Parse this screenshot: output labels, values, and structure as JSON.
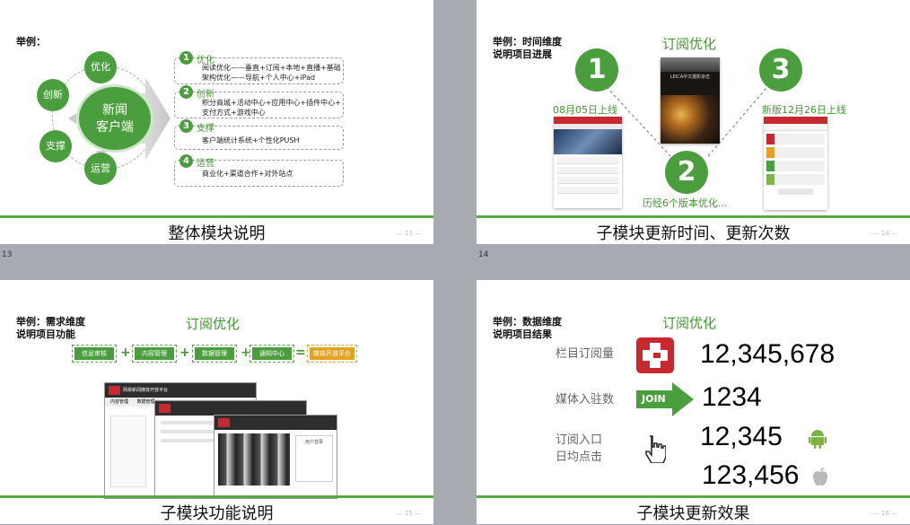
{
  "slides": [
    {
      "number": "13",
      "example": "举例：",
      "hub": "新闻客户端",
      "hub_line1": "新闻",
      "hub_line2": "客户端",
      "satellites": [
        "优化",
        "创新",
        "支撑",
        "运营"
      ],
      "items": [
        {
          "num": "1",
          "label": "优化",
          "lines": [
            "阅读优化——垂直+订阅+本地+直播+基础",
            "架构优化——导航+个人中心+iPad"
          ]
        },
        {
          "num": "2",
          "label": "创新",
          "lines": [
            "积分商城+活动中心+应用中心+插件中心+",
            "支付方式+游戏中心"
          ]
        },
        {
          "num": "3",
          "label": "支撑",
          "lines": [
            "客户端统计系统+个性化PUSH"
          ]
        },
        {
          "num": "4",
          "label": "运营",
          "lines": [
            "商业化+渠道合作+对外站点"
          ]
        }
      ],
      "title": "整体模块说明",
      "page": "— 13 —"
    },
    {
      "number": "14",
      "example_line1": "举例：时间维度",
      "example_line2": "说明项目进展",
      "heading": "订阅优化",
      "step1": "1",
      "step2": "2",
      "step3": "3",
      "label1": "08月05日上线",
      "label2": "历经6个版本优化...",
      "label3": "新版12月26日上线",
      "photo_caption": "LEICA中文摄影杂志",
      "title": "子模块更新时间、更新次数",
      "page": "— 14 —"
    },
    {
      "example_line1": "举例：需求维度",
      "example_line2": "说明项目功能",
      "heading": "订阅优化",
      "chips": [
        "信息审核",
        "内容管理",
        "数据管理",
        "通知中心"
      ],
      "result_chip": "媒体开放平台",
      "equals": "=",
      "plus": "+",
      "window_title": "网易新闻媒体开放平台",
      "tabs": [
        "内容管理",
        "数据管理"
      ],
      "login_title": "用户登录",
      "title": "子模块功能说明",
      "page": "— 15 —"
    },
    {
      "example_line1": "举例：数据维度",
      "example_line2": "说明项目结果",
      "heading": "订阅优化",
      "metrics": [
        {
          "label": "栏目订阅量",
          "value": "12,345,678"
        },
        {
          "label": "媒体入驻数",
          "value": "1234"
        }
      ],
      "join_label": "JOIN",
      "click_label_line1": "订阅入口",
      "click_label_line2": "日均点击",
      "android_value": "12,345",
      "ios_value": "123,456",
      "title": "子模块更新效果",
      "page": "— 16 —"
    }
  ],
  "colors": {
    "green": "#4a9e3d",
    "orange": "#e2a321",
    "red": "#c8282f",
    "background": "#a7aab0"
  },
  "icons": [
    "plus-red-logo",
    "join-arrow",
    "hand-cursor-icon",
    "android-icon",
    "apple-icon"
  ]
}
